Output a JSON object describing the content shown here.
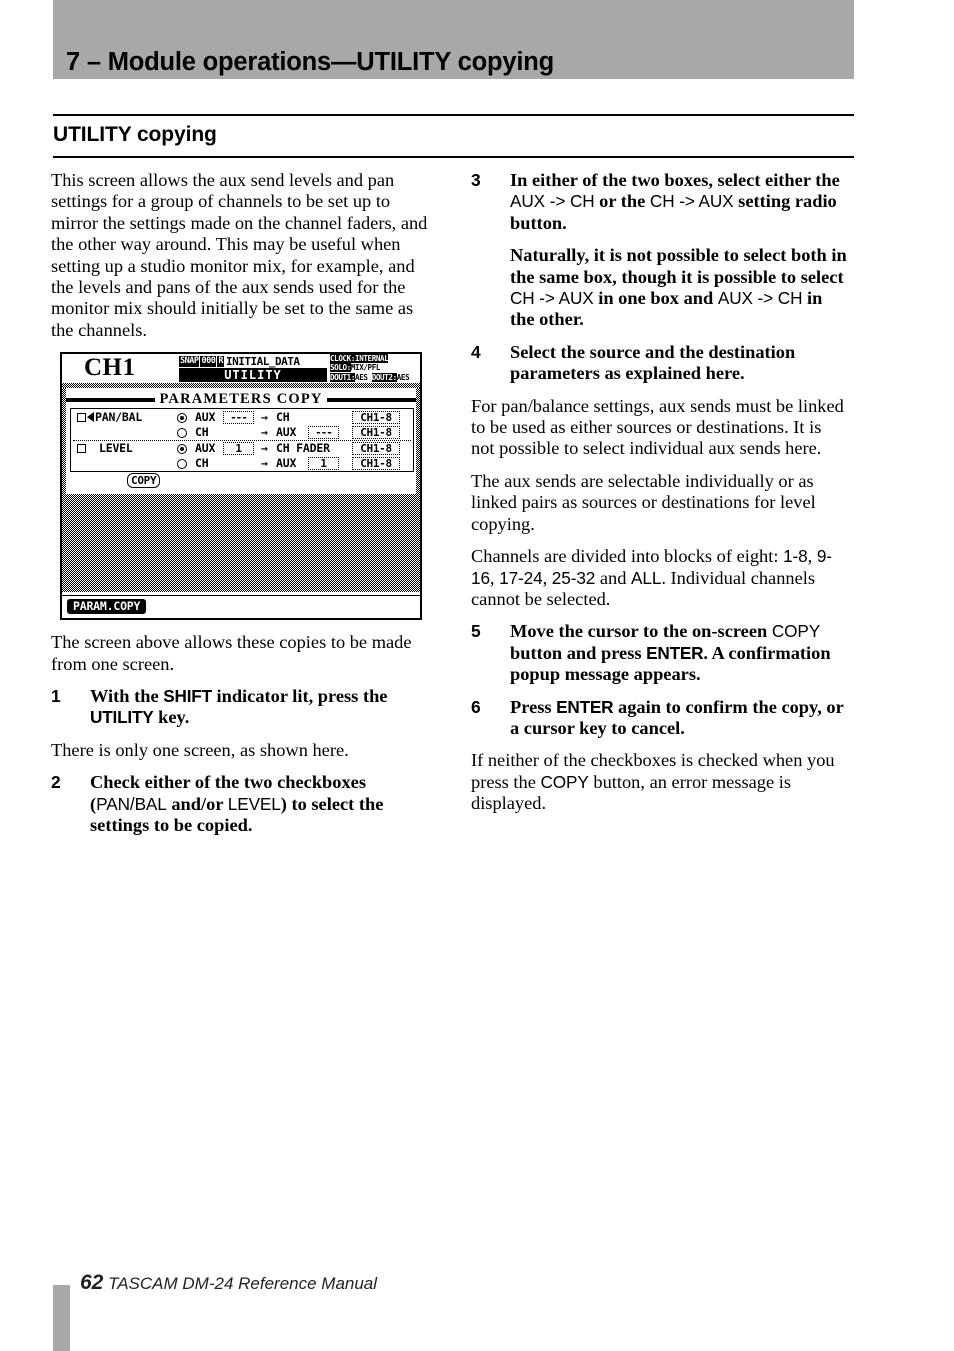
{
  "header": {
    "title": "7 – Module operations—UTILITY copying",
    "band_color": "#a8a8a8"
  },
  "section": {
    "heading": "UTILITY copying"
  },
  "left_column": {
    "intro": "This screen allows the aux send levels and pan settings for a group of channels to be set up to mirror the settings made on the channel faders, and the other way around. This may be useful when setting up a studio monitor mix, for example, and the levels and pans of the aux sends used for the monitor mix should initially be set to the same as the channels.",
    "after_figure": "The screen above allows these copies to be made from one screen.",
    "step1": {
      "number": "1",
      "part_a": "With the ",
      "key_a": "SHIFT",
      "part_b": " indicator lit, press the ",
      "key_b": "UTILITY",
      "part_c": " key."
    },
    "note1": "There is only one screen, as shown here.",
    "step2": {
      "number": "2",
      "part_a": "Check either of the two checkboxes (",
      "ui_a": "PAN/BAL",
      "part_b": " and/or ",
      "ui_b": "LEVEL",
      "part_c": ") to select the settings to be copied."
    }
  },
  "right_column": {
    "step3": {
      "number": "3",
      "part_a": "In either of the two boxes, select either the ",
      "ui_a": "AUX -> CH",
      "part_b": " or the ",
      "ui_b": "CH -> AUX",
      "part_c": " setting radio button."
    },
    "step3_note": {
      "part_a": "Naturally, it is not possible to select both in the same box, though it is possible to select ",
      "ui_a": "CH -> AUX",
      "part_b": " in one box and ",
      "ui_b": "AUX -> CH",
      "part_c": " in the other."
    },
    "step4": {
      "number": "4",
      "text": "Select the source and the destination parameters as explained here."
    },
    "para1": "For pan/balance settings, aux sends must be linked to be used as either sources or destinations. It is not possible to select individual aux sends here.",
    "para2": "The aux sends are selectable individually or as linked pairs as sources or destinations for level copying.",
    "para3": {
      "part_a": "Channels are divided into blocks of eight: ",
      "ui_a": "1-8",
      "part_b": ", ",
      "ui_b": "9-16",
      "part_c": ", ",
      "ui_c": "17-24",
      "part_d": ", ",
      "ui_d": "25-32",
      "part_e": " and ",
      "ui_e": "ALL",
      "part_f": ". Individual channels cannot be selected."
    },
    "step5": {
      "number": "5",
      "part_a": "Move the cursor to the on-screen ",
      "ui_a": "COPY",
      "part_b": " button and press ",
      "key_a": "ENTER",
      "part_c": ". A confirmation popup message appears."
    },
    "step6": {
      "number": "6",
      "part_a": "Press ",
      "key_a": "ENTER",
      "part_b": " again to confirm the copy, or a cursor key to cancel."
    },
    "closing": {
      "part_a": "If neither of the checkboxes is checked when you press the ",
      "ui_a": "COPY",
      "part_b": " button, an error message is displayed."
    }
  },
  "lcd": {
    "channel_name": "CH1",
    "snapshot": {
      "tag": "SNAP",
      "number": "000",
      "flag": "R",
      "name": "INITIAL_DATA",
      "mode": "UTILITY"
    },
    "status": {
      "clock_label": "CLOCK:",
      "clock_value": "INTERNAL",
      "solo_label": "SOLO:",
      "solo_value": "MIX/PFL",
      "dout1_label": "DOUT1:",
      "dout1_value": "AES",
      "dout2_label": "DOUT2:",
      "dout2_value": "AES"
    },
    "panel_title": "PARAMETERS COPY",
    "groups": [
      {
        "checkbox_label": "PAN/BAL",
        "checked": false,
        "cursor": true,
        "rows": [
          {
            "selected": true,
            "source": "AUX",
            "source_field": "---",
            "arrow": "→",
            "dest": "CH",
            "dest_field": "",
            "channels": "CH1-8"
          },
          {
            "selected": false,
            "source": "CH",
            "source_field": "",
            "arrow": "→",
            "dest": "AUX",
            "dest_field": "---",
            "channels": "CH1-8"
          }
        ]
      },
      {
        "checkbox_label": "LEVEL",
        "checked": false,
        "cursor": false,
        "rows": [
          {
            "selected": true,
            "source": "AUX",
            "source_field": "1",
            "arrow": "→",
            "dest": "CH FADER",
            "dest_field": "",
            "channels": "CH1-8"
          },
          {
            "selected": false,
            "source": "CH",
            "source_field": "",
            "arrow": "→",
            "dest": "AUX",
            "dest_field": "1",
            "channels": "CH1-8"
          }
        ]
      }
    ],
    "copy_button": "COPY",
    "tab_label": "PARAM.COPY"
  },
  "footer": {
    "page_number": "62",
    "manual_name": "TASCAM DM-24 Reference Manual"
  }
}
